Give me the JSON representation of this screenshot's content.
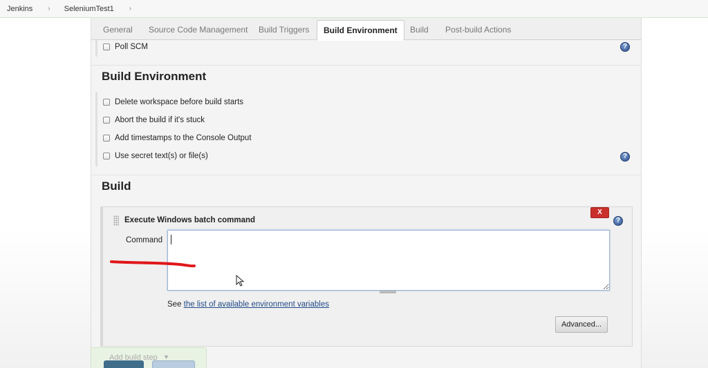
{
  "breadcrumb": {
    "items": [
      "Jenkins",
      "SeleniumTest1"
    ],
    "separator": "›"
  },
  "tabs": [
    {
      "label": "General"
    },
    {
      "label": "Source Code Management"
    },
    {
      "label": "Build Triggers"
    },
    {
      "label": "Build Environment",
      "active": true
    },
    {
      "label": "Build"
    },
    {
      "label": "Post-build Actions"
    }
  ],
  "triggers": {
    "poll_scm": "Poll SCM"
  },
  "build_environment": {
    "title": "Build Environment",
    "options": [
      "Delete workspace before build starts",
      "Abort the build if it's stuck",
      "Add timestamps to the Console Output",
      "Use secret text(s) or file(s)"
    ]
  },
  "build": {
    "title": "Build",
    "step": {
      "title": "Execute Windows batch command",
      "delete_label": "X",
      "command_label": "Command",
      "command_value": "",
      "see_prefix": "See ",
      "env_link": "the list of available environment variables",
      "advanced_label": "Advanced..."
    },
    "add_step_label": "Add build step"
  },
  "icons": {
    "help": "help-icon",
    "checkbox": "checkbox-icon",
    "drag": "drag-handle-icon"
  },
  "colors": {
    "delete_button": "#c9302c",
    "help_icon": "#2a4e8f",
    "annotation": "#e0161a"
  }
}
